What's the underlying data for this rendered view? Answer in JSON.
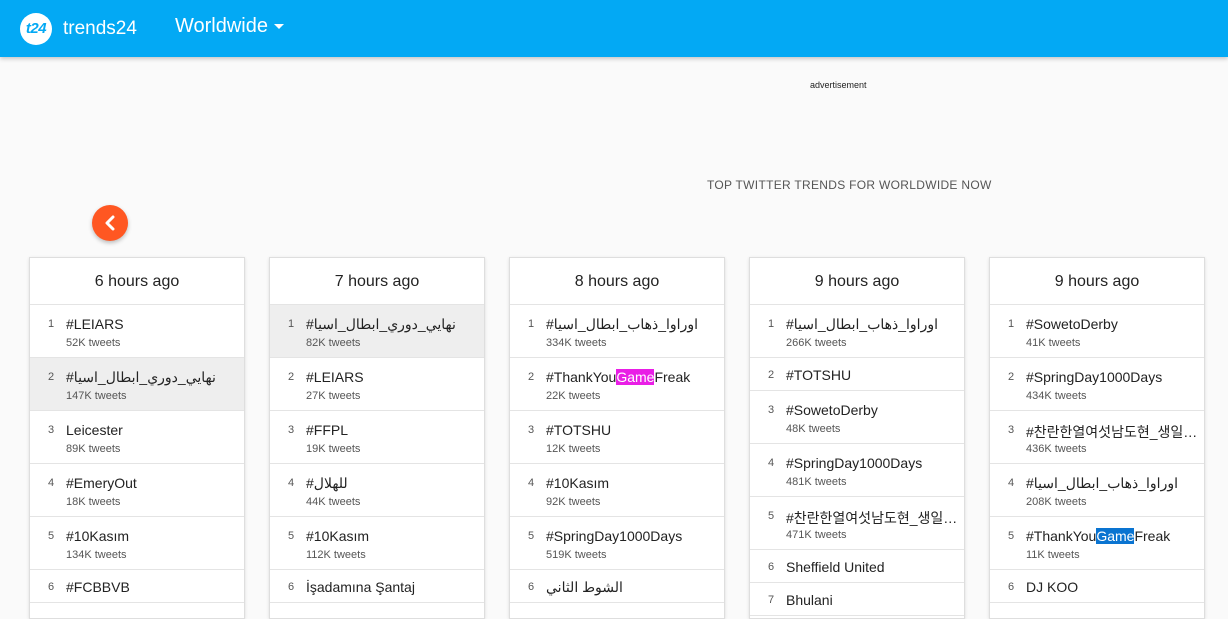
{
  "header": {
    "logo_badge": "t24",
    "logo_text": "trends24",
    "region": "Worldwide"
  },
  "ad_label": "advertisement",
  "page_heading": "TOP TWITTER TRENDS FOR WORLDWIDE NOW",
  "colors": {
    "topbar": "#03a9f4",
    "back_button": "#ff5722",
    "highlight_magenta": "#e91ee6",
    "highlight_blue": "#0a74d1"
  },
  "icons": {
    "back": "chevron-left-icon",
    "region_menu": "caret-down-icon"
  },
  "columns": [
    {
      "title": "6 hours ago",
      "trends": [
        {
          "rank": "1",
          "name": "#LEIARS",
          "count": "52K tweets"
        },
        {
          "rank": "2",
          "name": "#نهايي_دوري_ابطال_اسيا",
          "count": "147K tweets",
          "active": true
        },
        {
          "rank": "3",
          "name": "Leicester",
          "count": "89K tweets"
        },
        {
          "rank": "4",
          "name": "#EmeryOut",
          "count": "18K tweets"
        },
        {
          "rank": "5",
          "name": "#10Kasım",
          "count": "134K tweets"
        },
        {
          "rank": "6",
          "name": "#FCBBVB",
          "count": ""
        }
      ]
    },
    {
      "title": "7 hours ago",
      "trends": [
        {
          "rank": "1",
          "name": "#نهايي_دوري_ابطال_اسيا",
          "count": "82K tweets",
          "active": true
        },
        {
          "rank": "2",
          "name": "#LEIARS",
          "count": "27K tweets"
        },
        {
          "rank": "3",
          "name": "#FFPL",
          "count": "19K tweets"
        },
        {
          "rank": "4",
          "name": "#للهلال",
          "count": "44K tweets"
        },
        {
          "rank": "5",
          "name": "#10Kasım",
          "count": "112K tweets"
        },
        {
          "rank": "6",
          "name": "İşadamına Şantaj",
          "count": ""
        }
      ]
    },
    {
      "title": "8 hours ago",
      "trends": [
        {
          "rank": "1",
          "name": "#اوراوا_ذهاب_ابطال_اسيا",
          "count": "334K tweets"
        },
        {
          "rank": "2",
          "name": "#ThankYouGameFreak",
          "name_pre": "#ThankYou",
          "name_hl": "Game",
          "name_post": "Freak",
          "hl": "magenta",
          "count": "22K tweets"
        },
        {
          "rank": "3",
          "name": "#TOTSHU",
          "count": "12K tweets"
        },
        {
          "rank": "4",
          "name": "#10Kasım",
          "count": "92K tweets"
        },
        {
          "rank": "5",
          "name": "#SpringDay1000Days",
          "count": "519K tweets"
        },
        {
          "rank": "6",
          "name": "الشوط الثاني",
          "count": ""
        }
      ]
    },
    {
      "title": "9 hours ago",
      "trends": [
        {
          "rank": "1",
          "name": "#اوراوا_ذهاب_ابطال_اسيا",
          "count": "266K tweets"
        },
        {
          "rank": "2",
          "name": "#TOTSHU",
          "count": ""
        },
        {
          "rank": "3",
          "name": "#SowetoDerby",
          "count": "48K tweets"
        },
        {
          "rank": "4",
          "name": "#SpringDay1000Days",
          "count": "481K tweets"
        },
        {
          "rank": "5",
          "name": "#찬란한열여섯남도현_생일축하해",
          "count": "471K tweets"
        },
        {
          "rank": "6",
          "name": "Sheffield United",
          "count": ""
        },
        {
          "rank": "7",
          "name": "Bhulani",
          "count": ""
        }
      ]
    },
    {
      "title": "9 hours ago",
      "trends": [
        {
          "rank": "1",
          "name": "#SowetoDerby",
          "count": "41K tweets"
        },
        {
          "rank": "2",
          "name": "#SpringDay1000Days",
          "count": "434K tweets"
        },
        {
          "rank": "3",
          "name": "#찬란한열여섯남도현_생일축하해",
          "count": "436K tweets"
        },
        {
          "rank": "4",
          "name": "#اوراوا_ذهاب_ابطال_اسيا",
          "count": "208K tweets"
        },
        {
          "rank": "5",
          "name": "#ThankYouGameFreak",
          "name_pre": "#ThankYou",
          "name_hl": "Game",
          "name_post": "Freak",
          "hl": "blue",
          "count": "11K tweets"
        },
        {
          "rank": "6",
          "name": "DJ KOO",
          "count": ""
        }
      ]
    }
  ]
}
